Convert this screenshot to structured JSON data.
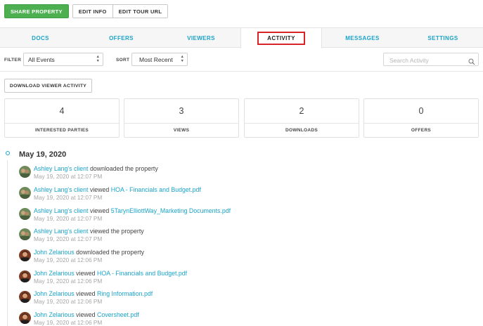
{
  "toolbar": {
    "share_label": "SHARE PROPERTY",
    "edit_info_label": "EDIT INFO",
    "edit_tour_label": "EDIT TOUR URL"
  },
  "tabs": [
    {
      "label": "DOCS"
    },
    {
      "label": "OFFERS"
    },
    {
      "label": "VIEWERS"
    },
    {
      "label": "ACTIVITY",
      "active": true
    },
    {
      "label": "MESSAGES"
    },
    {
      "label": "SETTINGS"
    }
  ],
  "filter": {
    "filter_label": "FILTER",
    "filter_value": "All Events",
    "sort_label": "SORT",
    "sort_value": "Most Recent",
    "search_placeholder": "Search Activity"
  },
  "download_button": "DOWNLOAD VIEWER ACTIVITY",
  "stats": [
    {
      "value": "4",
      "label": "INTERESTED PARTIES"
    },
    {
      "value": "3",
      "label": "VIEWS"
    },
    {
      "value": "2",
      "label": "DOWNLOADS"
    },
    {
      "value": "0",
      "label": "OFFERS"
    }
  ],
  "timeline": {
    "date": "May 19, 2020",
    "entries": [
      {
        "actor": "Ashley Lang's client",
        "action": "downloaded the property",
        "target": "",
        "time": "May 19, 2020 at 12:07 PM",
        "avatar": "avatar-ashley"
      },
      {
        "actor": "Ashley Lang's client",
        "action": "viewed",
        "target": "HOA - Financials and Budget.pdf",
        "time": "May 19, 2020 at 12:07 PM",
        "avatar": "avatar-ashley"
      },
      {
        "actor": "Ashley Lang's client",
        "action": "viewed",
        "target": "5TarynElliottWay_Marketing Documents.pdf",
        "time": "May 19, 2020 at 12:07 PM",
        "avatar": "avatar-ashley"
      },
      {
        "actor": "Ashley Lang's client",
        "action": "viewed the property",
        "target": "",
        "time": "May 19, 2020 at 12:07 PM",
        "avatar": "avatar-ashley"
      },
      {
        "actor": "John Zelarious",
        "action": "downloaded the property",
        "target": "",
        "time": "May 19, 2020 at 12:06 PM",
        "avatar": "avatar-john"
      },
      {
        "actor": "John Zelarious",
        "action": "viewed",
        "target": "HOA - Financials and Budget.pdf",
        "time": "May 19, 2020 at 12:06 PM",
        "avatar": "avatar-john"
      },
      {
        "actor": "John Zelarious",
        "action": "viewed",
        "target": "Ring Information.pdf",
        "time": "May 19, 2020 at 12:06 PM",
        "avatar": "avatar-john"
      },
      {
        "actor": "John Zelarious",
        "action": "viewed",
        "target": "Coversheet.pdf",
        "time": "May 19, 2020 at 12:06 PM",
        "avatar": "avatar-john"
      }
    ]
  },
  "colors": {
    "accent": "#1aa3c8",
    "share_green": "#4caf50",
    "active_tab_highlight": "#d9232b"
  }
}
